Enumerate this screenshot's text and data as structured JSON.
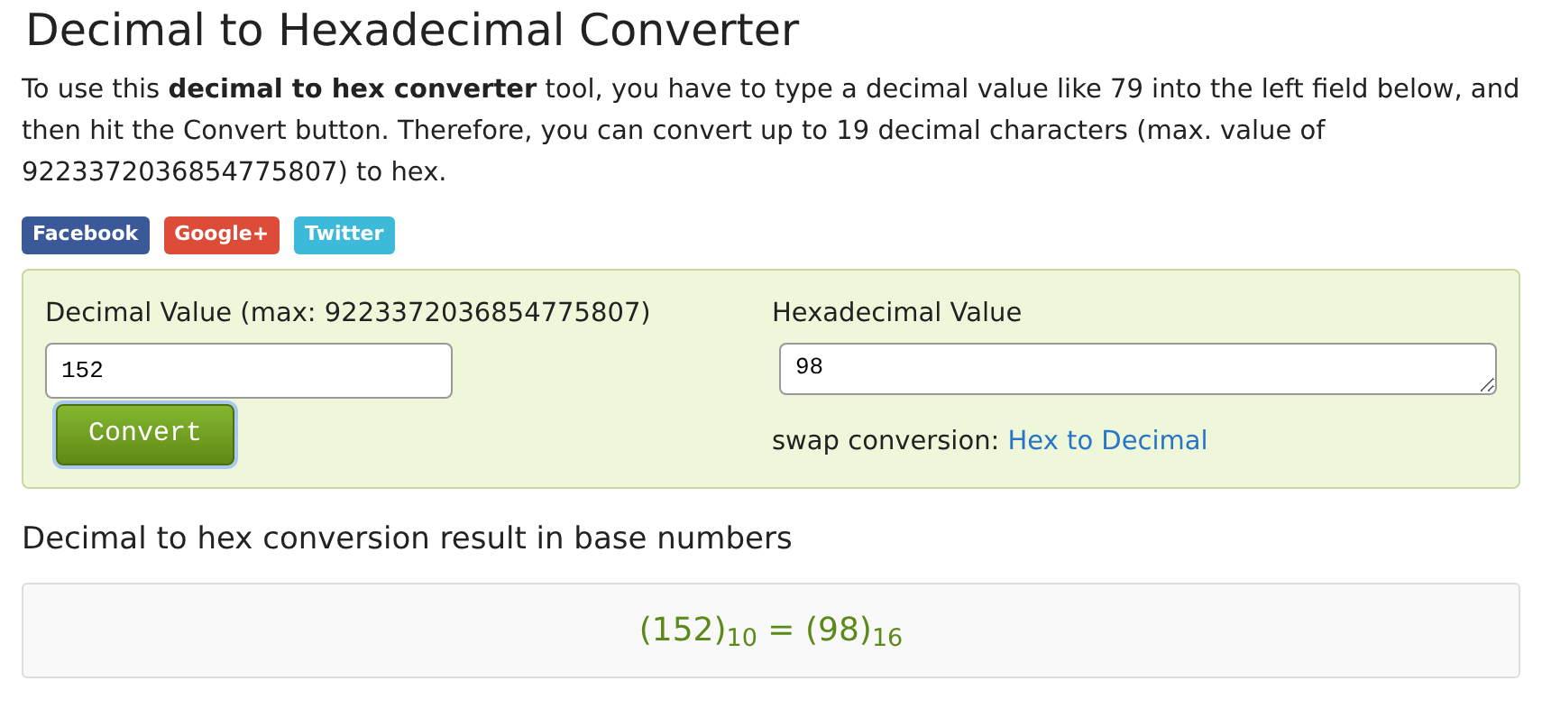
{
  "title": "Decimal to Hexadecimal Converter",
  "intro": "To use this **decimal to hex converter** tool, you have to type a decimal value like 79 into the left field below, and then hit the Convert button. Therefore, you can convert up to 19 decimal characters (max. value of 9223372036854775807) to hex.",
  "share_buttons": [
    {
      "label": "Facebook",
      "color": "#3b5998"
    },
    {
      "label": "Google+",
      "color": "#dd4b39"
    },
    {
      "label": "Twitter",
      "color": "#3db9d9"
    }
  ],
  "converter": {
    "input_label": "Decimal Value (max: 9223372036854775807)",
    "input_value": "152",
    "button": "Convert",
    "output_label": "Hexadecimal Value",
    "output_value": "98",
    "swap_label": "swap conversion:",
    "swap_link": "Hex to Decimal"
  },
  "result": {
    "heading": "Decimal to hex conversion result in base numbers",
    "formula": "(152)$_{10}$ = (98)$_{16}$"
  }
}
